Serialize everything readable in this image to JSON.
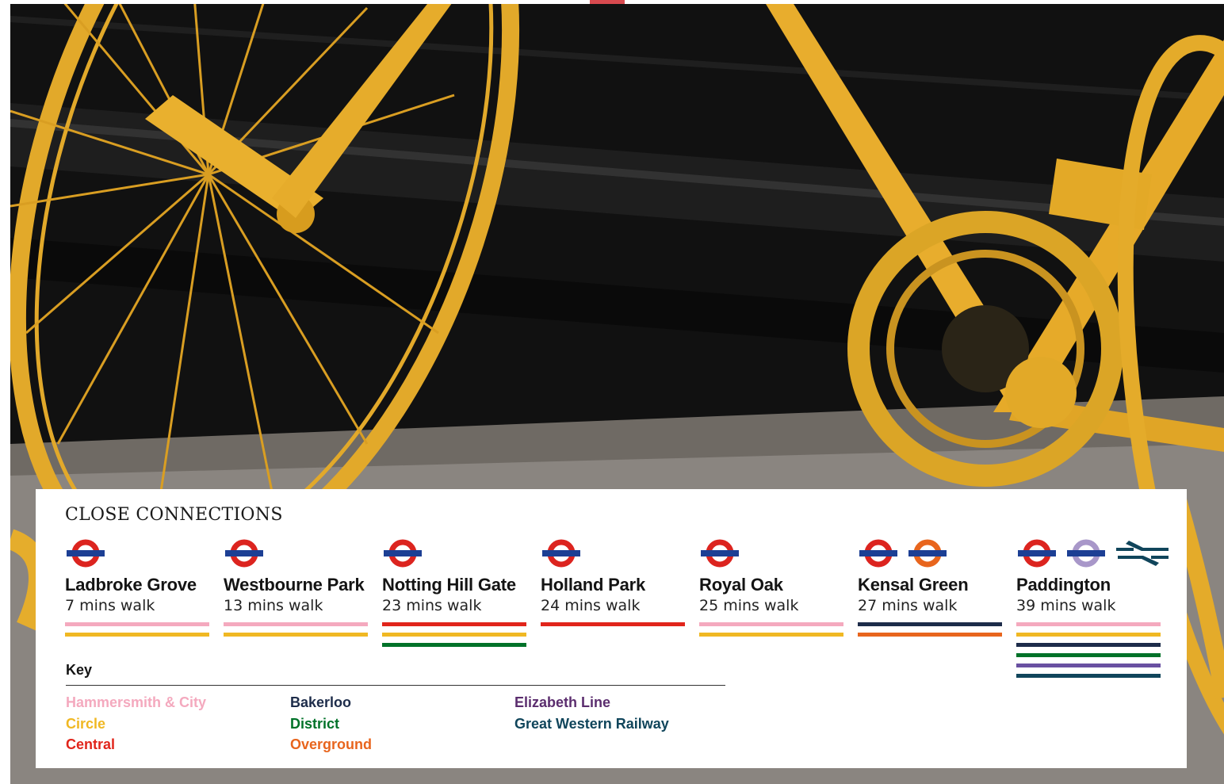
{
  "title": "CLOSE CONNECTIONS",
  "colors": {
    "underground_red": "#dc241f",
    "underground_blue": "#1c3f94",
    "hammersmith": "#f4a9be",
    "circle": "#f0b823",
    "central": "#e1251b",
    "bakerloo": "#1d2c4a",
    "district": "#007229",
    "overground": "#e8651d",
    "elizabeth": "#6950a1",
    "gwr": "#10455b",
    "elizabeth_line_text": "#5b2d6e"
  },
  "stations": [
    {
      "name": "Ladbroke Grove",
      "walk": "7 mins walk",
      "icons": [
        "underground-roundel-icon"
      ],
      "lines": [
        "hammersmith",
        "circle"
      ]
    },
    {
      "name": "Westbourne Park",
      "walk": "13 mins walk",
      "icons": [
        "underground-roundel-icon"
      ],
      "lines": [
        "hammersmith",
        "circle"
      ]
    },
    {
      "name": "Notting Hill Gate",
      "walk": "23 mins walk",
      "icons": [
        "underground-roundel-icon"
      ],
      "lines": [
        "central",
        "circle",
        "district"
      ]
    },
    {
      "name": "Holland Park",
      "walk": "24 mins walk",
      "icons": [
        "underground-roundel-icon"
      ],
      "lines": [
        "central"
      ]
    },
    {
      "name": "Royal Oak",
      "walk": "25 mins walk",
      "icons": [
        "underground-roundel-icon"
      ],
      "lines": [
        "hammersmith",
        "circle"
      ]
    },
    {
      "name": "Kensal Green",
      "walk": "27 mins walk",
      "icons": [
        "underground-roundel-icon",
        "overground-roundel-icon"
      ],
      "lines": [
        "bakerloo",
        "overground"
      ]
    },
    {
      "name": "Paddington",
      "walk": "39 mins walk",
      "icons": [
        "underground-roundel-icon",
        "elizabeth-roundel-icon",
        "national-rail-icon"
      ],
      "lines": [
        "hammersmith",
        "circle",
        "bakerloo",
        "district",
        "elizabeth",
        "gwr"
      ]
    }
  ],
  "key": {
    "title": "Key",
    "columns": [
      [
        {
          "label": "Hammersmith & City",
          "color": "#f4a9be"
        },
        {
          "label": "Circle",
          "color": "#f0b823"
        },
        {
          "label": "Central",
          "color": "#e1251b"
        }
      ],
      [
        {
          "label": "Bakerloo",
          "color": "#1d2c4a"
        },
        {
          "label": "District",
          "color": "#007229"
        },
        {
          "label": "Overground",
          "color": "#e8651d"
        }
      ],
      [
        {
          "label": "Elizabeth Line",
          "color": "#5b2d6e"
        },
        {
          "label": "Great Western Railway",
          "color": "#10455b"
        }
      ]
    ]
  }
}
